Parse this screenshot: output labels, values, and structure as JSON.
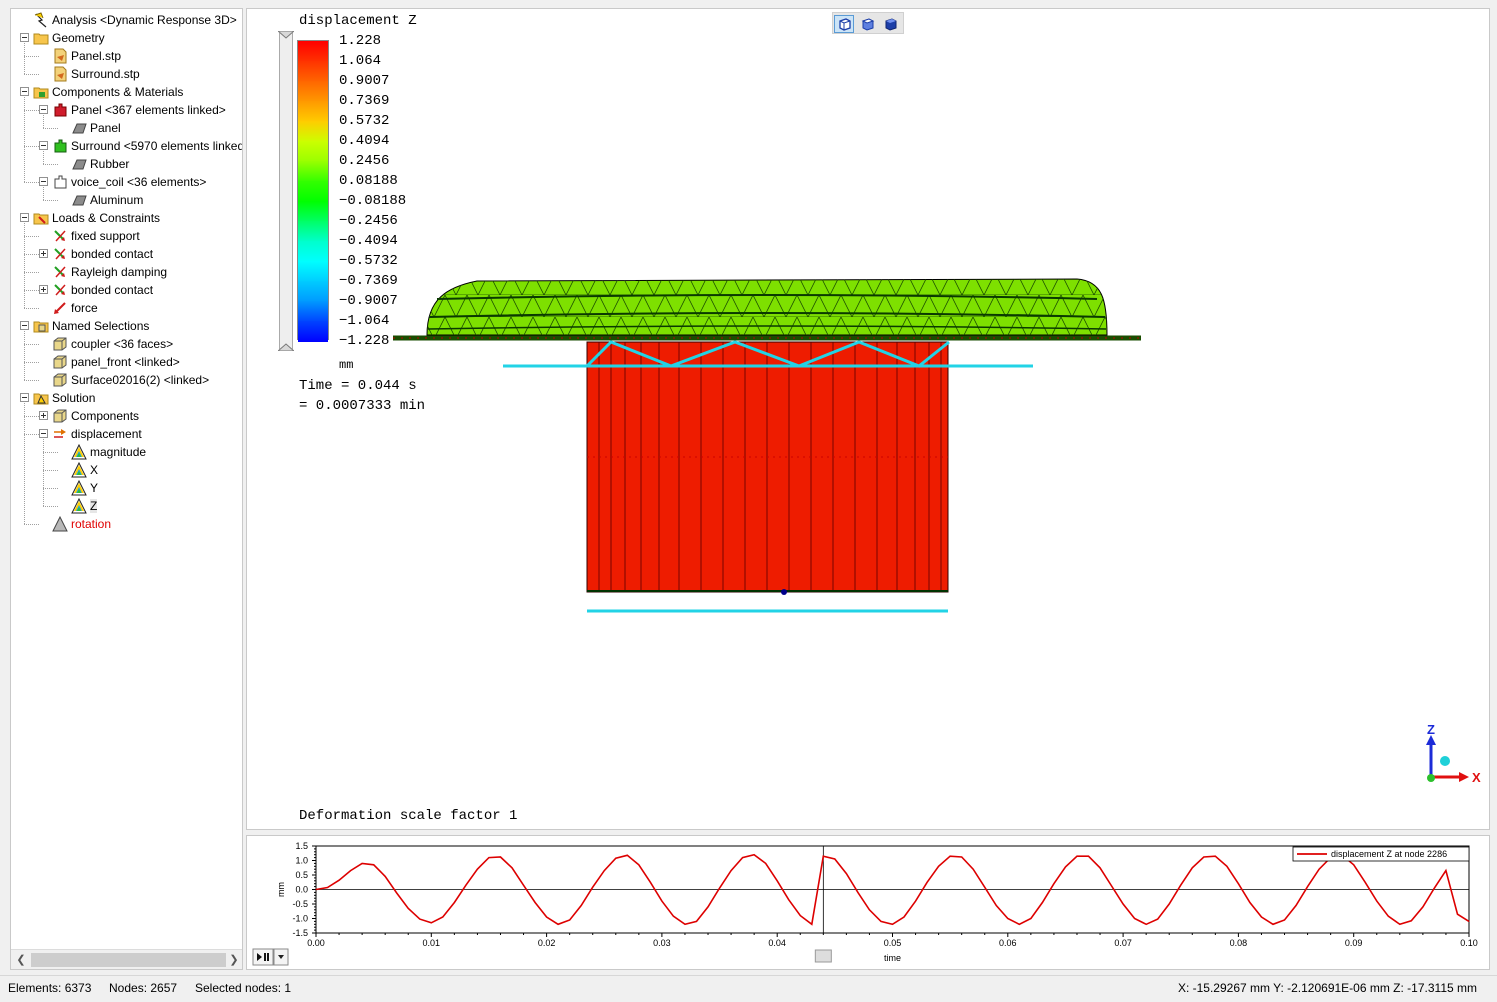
{
  "tree": {
    "items": [
      {
        "label": "Analysis <Dynamic Response 3D>",
        "icon": "analysis-icon"
      },
      {
        "label": "Geometry",
        "icon": "folder-icon"
      },
      {
        "label": "Panel.stp",
        "icon": "step-file-icon"
      },
      {
        "label": "Surround.stp",
        "icon": "step-file-icon"
      },
      {
        "label": "Components & Materials",
        "icon": "components-folder-icon"
      },
      {
        "label": "Panel <367 elements linked>",
        "icon": "component-red-icon"
      },
      {
        "label": "Panel",
        "icon": "material-icon"
      },
      {
        "label": "Surround <5970 elements linked",
        "icon": "component-green-icon"
      },
      {
        "label": "Rubber",
        "icon": "material-icon"
      },
      {
        "label": "voice_coil <36 elements>",
        "icon": "component-white-icon"
      },
      {
        "label": "Aluminum",
        "icon": "material-icon"
      },
      {
        "label": "Loads & Constraints",
        "icon": "loads-folder-icon"
      },
      {
        "label": "fixed support",
        "icon": "constraint-icon"
      },
      {
        "label": "bonded contact",
        "icon": "constraint-icon"
      },
      {
        "label": "Rayleigh damping",
        "icon": "constraint-icon"
      },
      {
        "label": "bonded contact",
        "icon": "constraint-icon"
      },
      {
        "label": "force",
        "icon": "load-icon"
      },
      {
        "label": "Named Selections",
        "icon": "selections-folder-icon"
      },
      {
        "label": "coupler <36 faces>",
        "icon": "selection-icon"
      },
      {
        "label": "panel_front <linked>",
        "icon": "selection-icon"
      },
      {
        "label": "Surface02016(2) <linked>",
        "icon": "selection-icon"
      },
      {
        "label": "Solution",
        "icon": "solution-folder-icon"
      },
      {
        "label": "Components",
        "icon": "selection-icon"
      },
      {
        "label": "displacement",
        "icon": "displacement-icon"
      },
      {
        "label": "magnitude",
        "icon": "result-icon"
      },
      {
        "label": "X",
        "icon": "result-icon"
      },
      {
        "label": "Y",
        "icon": "result-icon"
      },
      {
        "label": "Z",
        "icon": "result-icon"
      },
      {
        "label": "rotation",
        "icon": "result-grey-icon"
      }
    ]
  },
  "viewport": {
    "title": "displacement Z",
    "unit": "mm",
    "time_line1": "Time = 0.044 s",
    "time_line2": "= 0.0007333 min",
    "deformation": "Deformation scale factor 1",
    "legend_values": [
      "1.228",
      "1.064",
      "0.9007",
      "0.7369",
      "0.5732",
      "0.4094",
      "0.2456",
      "0.08188",
      "−0.08188",
      "−0.2456",
      "−0.4094",
      "−0.5732",
      "−0.7369",
      "−0.9007",
      "−1.064",
      "−1.228"
    ],
    "legend_colors": [
      "#ff0000",
      "#ff3300",
      "#ff6600",
      "#ff9900",
      "#ffcc00",
      "#ccff00",
      "#99ff00",
      "#33ff00",
      "#00ff00",
      "#00ff66",
      "#00ffcc",
      "#00ffff",
      "#00ccff",
      "#0099ff",
      "#0044ff",
      "#0000ff"
    ],
    "toolbar": [
      "view-front-icon",
      "view-shaded-icon",
      "view-solid-icon"
    ],
    "triad": {
      "x": "X",
      "z": "Z"
    }
  },
  "chart_data": {
    "type": "line",
    "xlabel": "time",
    "ylabel": "mm",
    "xlim": [
      0,
      0.1
    ],
    "ylim": [
      -1.5,
      1.5
    ],
    "xticks": [
      "0.00",
      "0.01",
      "0.02",
      "0.03",
      "0.04",
      "0.05",
      "0.06",
      "0.07",
      "0.08",
      "0.09",
      "0.10"
    ],
    "yticks": [
      "1.5",
      "1.0",
      "0.5",
      "0.0",
      "-0.5",
      "-1.0",
      "-1.5"
    ],
    "cursor_x": 0.044,
    "series": [
      {
        "name": "displacement Z at node 2286",
        "color": "#dd0000",
        "x": [
          0,
          0.001,
          0.002,
          0.003,
          0.004,
          0.005,
          0.006,
          0.007,
          0.008,
          0.009,
          0.01,
          0.011,
          0.012,
          0.013,
          0.014,
          0.015,
          0.016,
          0.017,
          0.018,
          0.019,
          0.02,
          0.021,
          0.022,
          0.023,
          0.024,
          0.025,
          0.026,
          0.027,
          0.028,
          0.029,
          0.03,
          0.031,
          0.032,
          0.033,
          0.034,
          0.035,
          0.036,
          0.037,
          0.038,
          0.039,
          0.04,
          0.041,
          0.042,
          0.043,
          0.044,
          0.045,
          0.046,
          0.047,
          0.048,
          0.049,
          0.05,
          0.051,
          0.052,
          0.053,
          0.054,
          0.055,
          0.056,
          0.057,
          0.058,
          0.059,
          0.06,
          0.061,
          0.062,
          0.063,
          0.064,
          0.065,
          0.066,
          0.067,
          0.068,
          0.069,
          0.07,
          0.071,
          0.072,
          0.073,
          0.074,
          0.075,
          0.076,
          0.077,
          0.078,
          0.079,
          0.08,
          0.081,
          0.082,
          0.083,
          0.084,
          0.085,
          0.086,
          0.087,
          0.088,
          0.089,
          0.09,
          0.091,
          0.092,
          0.093,
          0.094,
          0.095,
          0.096,
          0.097,
          0.098,
          0.099,
          0.1
        ],
        "y": [
          0.0,
          0.07,
          0.32,
          0.65,
          0.9,
          0.85,
          0.45,
          -0.12,
          -0.65,
          -1.02,
          -1.15,
          -0.95,
          -0.45,
          0.15,
          0.7,
          1.1,
          1.12,
          0.75,
          0.15,
          -0.45,
          -0.95,
          -1.2,
          -1.05,
          -0.55,
          0.08,
          0.65,
          1.08,
          1.18,
          0.85,
          0.25,
          -0.4,
          -0.92,
          -1.2,
          -1.1,
          -0.6,
          0.05,
          0.65,
          1.1,
          1.2,
          0.9,
          0.3,
          -0.35,
          -0.9,
          -1.2,
          1.15,
          1.05,
          0.55,
          -0.1,
          -0.7,
          -1.1,
          -1.2,
          -0.95,
          -0.4,
          0.25,
          0.8,
          1.15,
          1.12,
          0.7,
          0.08,
          -0.55,
          -1.0,
          -1.2,
          -1.0,
          -0.45,
          0.2,
          0.78,
          1.15,
          1.15,
          0.75,
          0.12,
          -0.5,
          -1.0,
          -1.2,
          -1.02,
          -0.5,
          0.15,
          0.75,
          1.12,
          1.15,
          0.8,
          0.2,
          -0.45,
          -0.95,
          -1.2,
          -1.05,
          -0.55,
          0.1,
          0.7,
          1.1,
          1.18,
          0.85,
          0.25,
          -0.4,
          -0.92,
          -1.2,
          -1.08,
          -0.6,
          0.05,
          0.65,
          -0.85,
          -1.1
        ]
      }
    ]
  },
  "status": {
    "elements": "Elements: 6373",
    "nodes": "Nodes: 2657",
    "selected": "Selected nodes: 1",
    "coords": "X: -15.29267 mm Y: -2.120691E-06 mm Z: -17.3115 mm"
  }
}
